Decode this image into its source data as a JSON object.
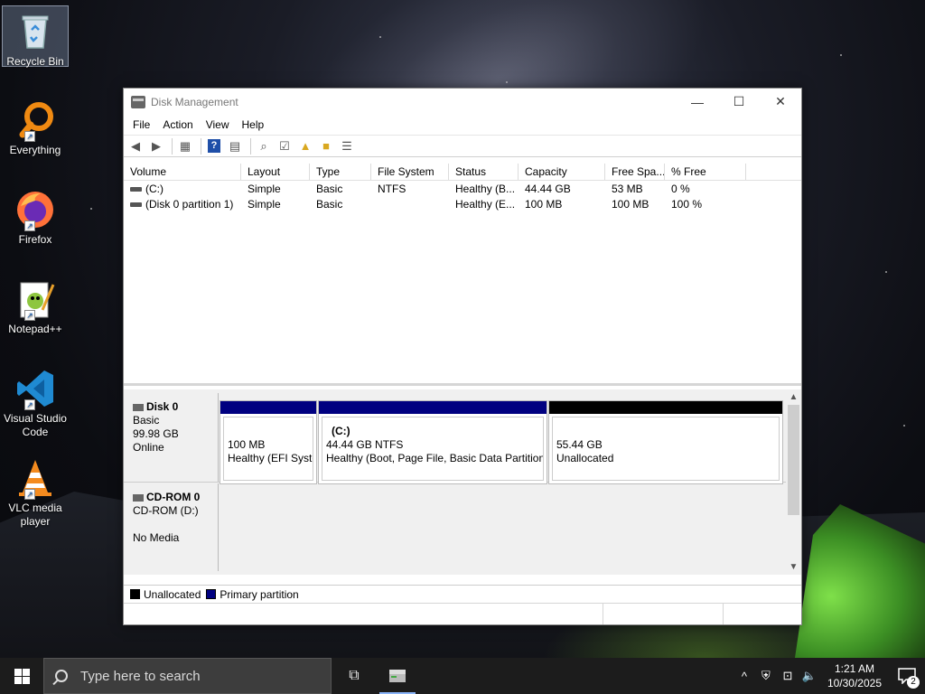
{
  "desktop": {
    "icons": [
      {
        "label": "Recycle Bin",
        "icon": "recycle-bin-icon"
      },
      {
        "label": "Everything",
        "icon": "everything-icon"
      },
      {
        "label": "Firefox",
        "icon": "firefox-icon"
      },
      {
        "label": "Notepad++",
        "icon": "notepad-plus-plus-icon"
      },
      {
        "label": "Visual Studio Code",
        "icon": "vscode-icon"
      },
      {
        "label": "VLC media player",
        "icon": "vlc-icon"
      }
    ]
  },
  "window": {
    "title": "Disk Management",
    "controls": {
      "minimize": "—",
      "maximize": "☐",
      "close": "✕"
    },
    "menu": [
      "File",
      "Action",
      "View",
      "Help"
    ]
  },
  "volumes": {
    "columns": [
      "Volume",
      "Layout",
      "Type",
      "File System",
      "Status",
      "Capacity",
      "Free Spa...",
      "% Free"
    ],
    "rows": [
      [
        "(C:)",
        "Simple",
        "Basic",
        "NTFS",
        "Healthy (B...",
        "44.44 GB",
        "53 MB",
        "0 %"
      ],
      [
        "(Disk 0 partition 1)",
        "Simple",
        "Basic",
        "",
        "Healthy (E...",
        "100 MB",
        "100 MB",
        "100 %"
      ]
    ]
  },
  "disks": {
    "disk0": {
      "name": "Disk 0",
      "type": "Basic",
      "size": "99.98 GB",
      "state": "Online",
      "partitions": [
        {
          "title": "",
          "size": "100 MB",
          "status": "Healthy (EFI Syste"
        },
        {
          "title": "(C:)",
          "size": "44.44 GB NTFS",
          "status": "Healthy (Boot, Page File, Basic Data Partition)"
        },
        {
          "title": "",
          "size": "55.44 GB",
          "status": "Unallocated"
        }
      ]
    },
    "cdrom0": {
      "name": "CD-ROM 0",
      "drive": "CD-ROM (D:)",
      "media": "No Media"
    }
  },
  "legend": [
    {
      "label": "Unallocated",
      "color": "#000000"
    },
    {
      "label": "Primary partition",
      "color": "#000080"
    }
  ],
  "colors": {
    "primary": "#000080",
    "unallocated": "#000000"
  },
  "taskbar": {
    "search_placeholder": "Type here to search",
    "time": "1:21 AM",
    "date": "10/30/2025",
    "notification_count": "2"
  }
}
